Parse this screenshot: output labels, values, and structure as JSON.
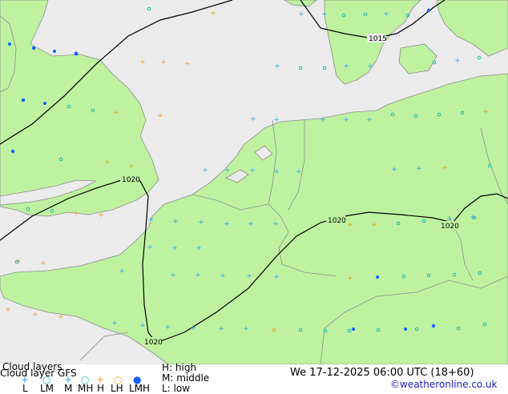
{
  "map": {
    "isobar_labels": [
      "1015",
      "1020",
      "1020",
      "1020",
      "1020"
    ],
    "colors": {
      "sea": "#ebebeb",
      "land": "#bff2a0",
      "border": "#8c8c8c",
      "isobar": "#000000",
      "low": "#2aa8f0",
      "middle": "#18b8a8",
      "high": "#e8a020",
      "blue_symbol": "#1060ff"
    }
  },
  "legend": {
    "title": "Cloud layers",
    "model": "Cloud layer  GFS",
    "keys": [
      "L",
      "LM",
      "M",
      "MH",
      "H",
      "LH",
      "LMH"
    ],
    "levels": [
      "H: high",
      "M: middle",
      "L: low"
    ],
    "datetime": "We 17-12-2025 06:00 UTC (18+60)",
    "credit": "©weatheronline.co.uk"
  }
}
